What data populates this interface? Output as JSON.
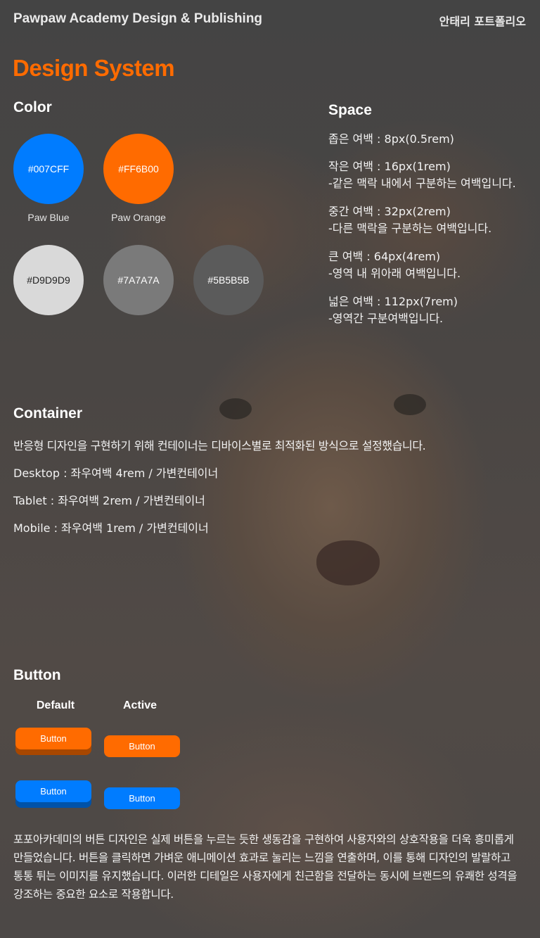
{
  "header": {
    "site_title": "Pawpaw Academy Design & Publishing",
    "portfolio_label": "안태리 포트폴리오"
  },
  "page_title": "Design System",
  "color": {
    "title": "Color",
    "swatches": [
      {
        "hex": "#007CFF",
        "name": "Paw Blue",
        "color": "#007CFF",
        "text_color": "#ffffff"
      },
      {
        "hex": "#FF6B00",
        "name": "Paw Orange",
        "color": "#FF6B00",
        "text_color": "#ffffff"
      },
      {
        "hex": "#D9D9D9",
        "name": "",
        "color": "#D9D9D9",
        "text_color": "#222222"
      },
      {
        "hex": "#7A7A7A",
        "name": "",
        "color": "#7A7A7A",
        "text_color": "#ffffff"
      },
      {
        "hex": "#5B5B5B",
        "name": "",
        "color": "#5B5B5B",
        "text_color": "#ffffff"
      }
    ]
  },
  "space": {
    "title": "Space",
    "items": [
      {
        "line1": "좁은 여백 : 8px(0.5rem)",
        "line2": ""
      },
      {
        "line1": "작은 여백 : 16px(1rem)",
        "line2": "-같은 맥락 내에서 구분하는 여백입니다."
      },
      {
        "line1": "중간 여백 : 32px(2rem)",
        "line2": "-다른 맥락을 구분하는 여백입니다."
      },
      {
        "line1": "큰 여백 : 64px(4rem)",
        "line2": "-영역 내 위아래 여백입니다."
      },
      {
        "line1": "넓은 여백 : 112px(7rem)",
        "line2": "-영역간 구분여백입니다."
      }
    ]
  },
  "container": {
    "title": "Container",
    "description": "반응형 디자인을 구현하기 위해 컨테이너는 디바이스별로 최적화된 방식으로 설정했습니다.",
    "desktop": "Desktop : 좌우여백 4rem / 가변컨테이너",
    "tablet": "Tablet : 좌우여백 2rem / 가변컨테이너",
    "mobile": "Mobile : 좌우여백 1rem / 가변컨테이너"
  },
  "button": {
    "title": "Button",
    "default_label": "Default",
    "active_label": "Active",
    "orange_default": "Button",
    "orange_active": "Button",
    "blue_default": "Button",
    "blue_active": "Button",
    "description": "포포아카데미의 버튼 디자인은 실제 버튼을 누르는 듯한 생동감을 구현하여 사용자와의 상호작용을 더욱 흥미롭게 만들었습니다. 버튼을 클릭하면 가벼운 애니메이션 효과로 눌리는 느낌을 연출하며, 이를 통해 디자인의 발랄하고 통통 튀는 이미지를 유지했습니다. 이러한 디테일은 사용자에게 친근함을 전달하는 동시에 브랜드의 유쾌한 성격을 강조하는 중요한 요소로 작용합니다."
  },
  "colors": {
    "accent_orange": "#FF6B00",
    "accent_blue": "#007CFF"
  }
}
